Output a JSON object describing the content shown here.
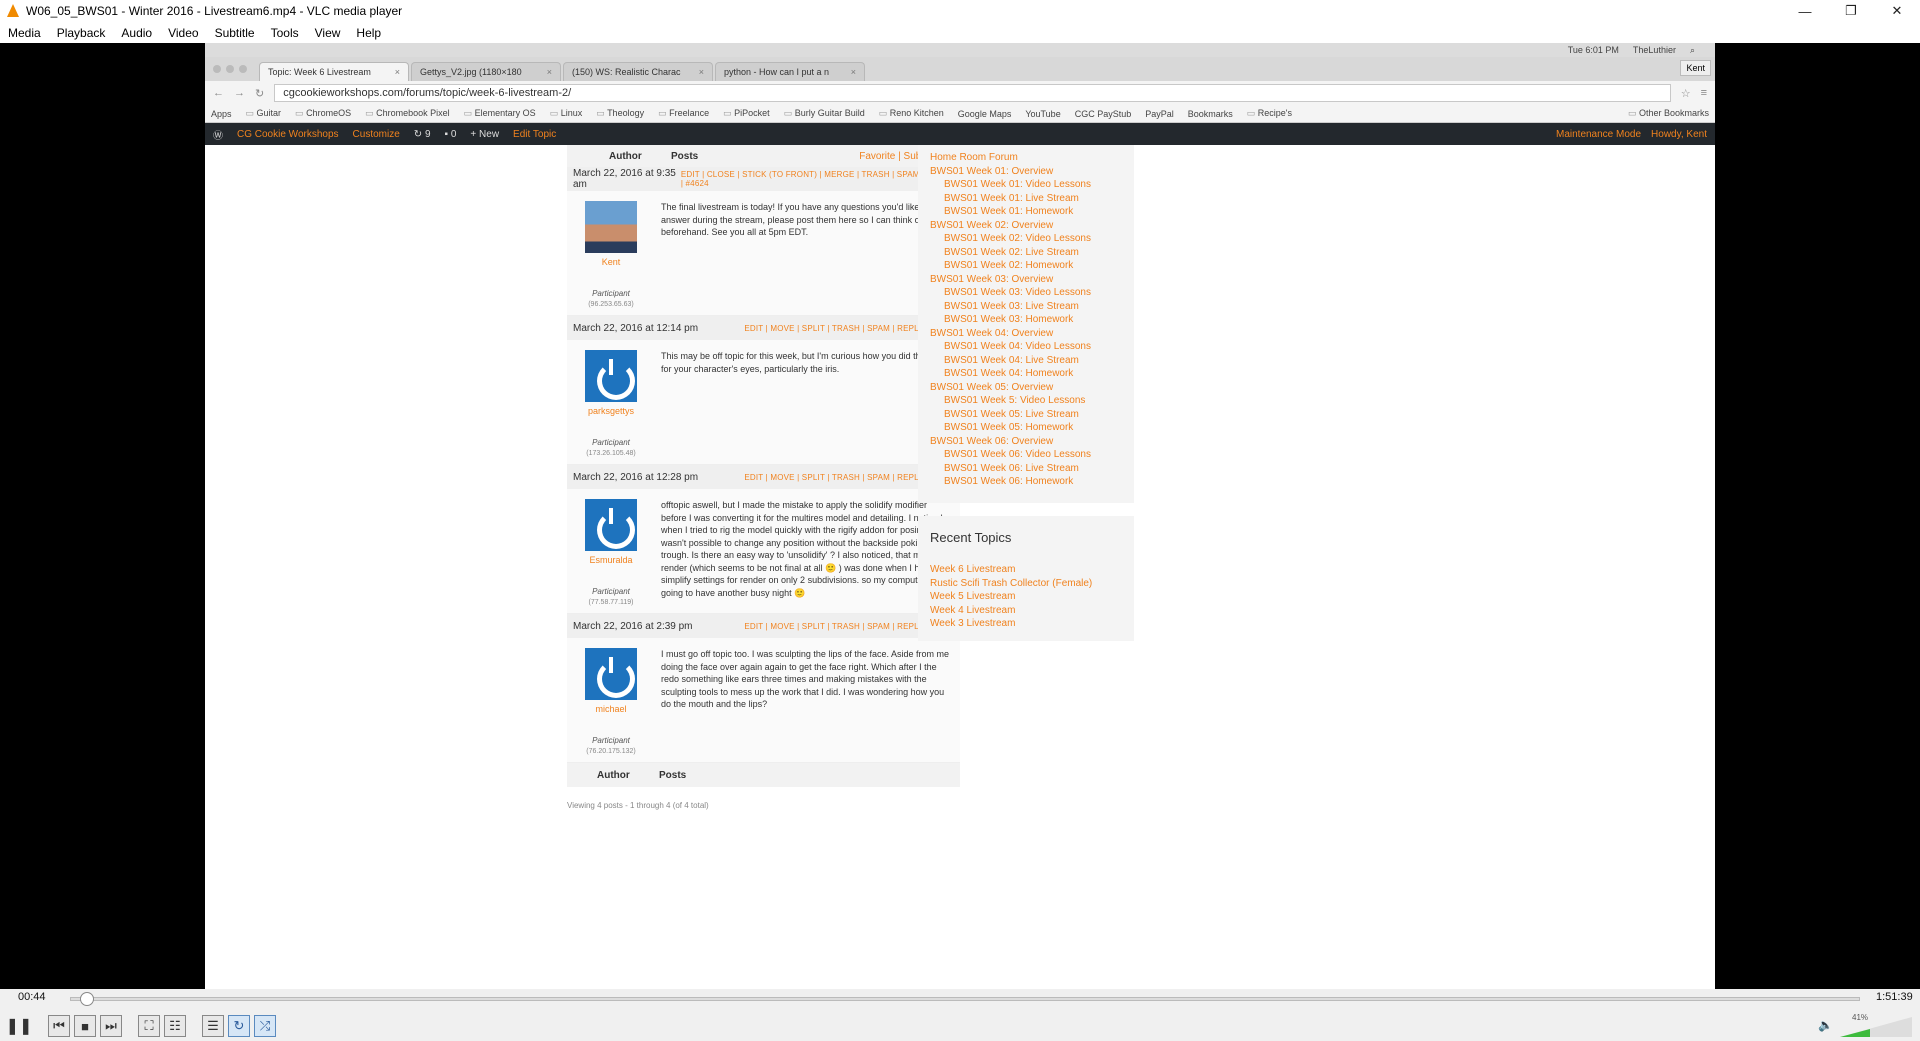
{
  "window": {
    "title": "W06_05_BWS01 - Winter 2016 - Livestream6.mp4 - VLC media player"
  },
  "menu": [
    "Media",
    "Playback",
    "Audio",
    "Video",
    "Subtitle",
    "Tools",
    "View",
    "Help"
  ],
  "mac": {
    "clock": "Tue 6:01 PM",
    "user": "TheLuthier"
  },
  "browser": {
    "tabs": [
      {
        "label": "Topic: Week 6 Livestream"
      },
      {
        "label": "Gettys_V2.jpg (1180×180"
      },
      {
        "label": "(150) WS: Realistic Charac"
      },
      {
        "label": "python - How can I put a n"
      }
    ],
    "profile": "Kent",
    "url": "cgcookieworkshops.com/forums/topic/week-6-livestream-2/",
    "bookmarks": [
      "Apps",
      "Guitar",
      "ChromeOS",
      "Chromebook Pixel",
      "Elementary OS",
      "Linux",
      "Theology",
      "Freelance",
      "PiPocket",
      "Burly Guitar Build",
      "Reno Kitchen",
      "Google Maps",
      "YouTube",
      "CGC PayStub",
      "PayPal",
      "Bookmarks",
      "Recipe's"
    ],
    "other_bookmarks": "Other Bookmarks"
  },
  "wpbar": {
    "site": "CG Cookie Workshops",
    "customize": "Customize",
    "updates": "9",
    "comments": "0",
    "new": "New",
    "edit": "Edit Topic",
    "maintenance": "Maintenance Mode",
    "howdy": "Howdy, Kent"
  },
  "forum": {
    "header": {
      "author": "Author",
      "posts": "Posts",
      "favorite": "Favorite",
      "subscribe": "Subscribe"
    },
    "posts": [
      {
        "date": "March 22, 2016 at 9:35 am",
        "actions": "EDIT | CLOSE | STICK (TO FRONT) | MERGE | TRASH | SPAM | REPLY",
        "id": "#4624",
        "author": "Kent",
        "role": "Participant",
        "ip": "(96.253.65.63)",
        "avatar": "photo",
        "text": "The final livestream is today! If you have any questions you'd like me answer during the stream, please post them here so I can think on them beforehand. See you all at 5pm EDT."
      },
      {
        "date": "March 22, 2016 at 12:14 pm",
        "actions": "EDIT | MOVE | SPLIT | TRASH | SPAM | REPLY",
        "id": "#4625",
        "author": "parksgettys",
        "role": "Participant",
        "ip": "(173.26.105.48)",
        "avatar": "ring",
        "text": "This may be off topic for this week, but I'm curious how you did the detail for your character's eyes, particularly the iris."
      },
      {
        "date": "March 22, 2016 at 12:28 pm",
        "actions": "EDIT | MOVE | SPLIT | TRASH | SPAM | REPLY",
        "id": "#4626",
        "author": "Esmuralda",
        "role": "Participant",
        "ip": "(77.58.77.119)",
        "avatar": "ring",
        "text": "offtopic aswell, but I made the mistake to apply the solidify modifier before I was converting it for the multires model and detailing. I noticed when I tried to rig the model quickly with the rigify addon for posing. but it wasn't possible to change any position without the backside poking trough. Is there an easy way to 'unsolidify' ? I also noticed, that my final render (which seems to be not final at all 🙂 ) was done when I had the simplify settings for render on only 2 subdivisions. so my computer is going to have another busy night 🙂"
      },
      {
        "date": "March 22, 2016 at 2:39 pm",
        "actions": "EDIT | MOVE | SPLIT | TRASH | SPAM | REPLY",
        "id": "#4627",
        "author": "michael",
        "role": "Participant",
        "ip": "(76.20.175.132)",
        "avatar": "ring",
        "text": "I must go off topic too. I was sculpting the lips of the face. Aside from me doing the face over again again to get the face right. Which after I the redo something like ears three times and making mistakes with the sculpting tools to mess up the work that I did. I was wondering how you do the mouth and the lips?"
      }
    ],
    "footer": {
      "author": "Author",
      "posts": "Posts"
    },
    "viewing": "Viewing 4 posts - 1 through 4 (of 4 total)"
  },
  "sidebar": {
    "forum_items": [
      {
        "label": "Home Room Forum",
        "sub": false
      },
      {
        "label": "BWS01 Week 01: Overview",
        "sub": false
      },
      {
        "label": "BWS01 Week 01: Video Lessons",
        "sub": true
      },
      {
        "label": "BWS01 Week 01: Live Stream",
        "sub": true
      },
      {
        "label": "BWS01 Week 01: Homework",
        "sub": true
      },
      {
        "label": "BWS01 Week 02: Overview",
        "sub": false
      },
      {
        "label": "BWS01 Week 02: Video Lessons",
        "sub": true
      },
      {
        "label": "BWS01 Week 02: Live Stream",
        "sub": true
      },
      {
        "label": "BWS01 Week 02: Homework",
        "sub": true
      },
      {
        "label": "BWS01 Week 03: Overview",
        "sub": false
      },
      {
        "label": "BWS01 Week 03: Video Lessons",
        "sub": true
      },
      {
        "label": "BWS01 Week 03: Live Stream",
        "sub": true
      },
      {
        "label": "BWS01 Week 03: Homework",
        "sub": true
      },
      {
        "label": "BWS01 Week 04: Overview",
        "sub": false
      },
      {
        "label": "BWS01 Week 04: Video Lessons",
        "sub": true
      },
      {
        "label": "BWS01 Week 04: Live Stream",
        "sub": true
      },
      {
        "label": "BWS01 Week 04: Homework",
        "sub": true
      },
      {
        "label": "BWS01 Week 05: Overview",
        "sub": false
      },
      {
        "label": "BWS01 Week 5: Video Lessons",
        "sub": true
      },
      {
        "label": "BWS01 Week 05: Live Stream",
        "sub": true
      },
      {
        "label": "BWS01 Week 05: Homework",
        "sub": true
      },
      {
        "label": "BWS01 Week 06: Overview",
        "sub": false
      },
      {
        "label": "BWS01 Week 06: Video Lessons",
        "sub": true
      },
      {
        "label": "BWS01 Week 06: Live Stream",
        "sub": true
      },
      {
        "label": "BWS01 Week 06: Homework",
        "sub": true
      }
    ],
    "recent_title": "Recent Topics",
    "recent": [
      "Week 6 Livestream",
      "Rustic Scifi Trash Collector (Female)",
      "Week 5 Livestream",
      "Week 4 Livestream",
      "Week 3 Livestream"
    ]
  },
  "player": {
    "elapsed": "00:44",
    "total": "1:51:39",
    "progress": 0.0066,
    "volume": "41%",
    "volume_level": 0.41
  },
  "colors": {
    "accent": "#f0821e",
    "wp_bar": "#23282d",
    "avatar_blue": "#1e73be"
  }
}
